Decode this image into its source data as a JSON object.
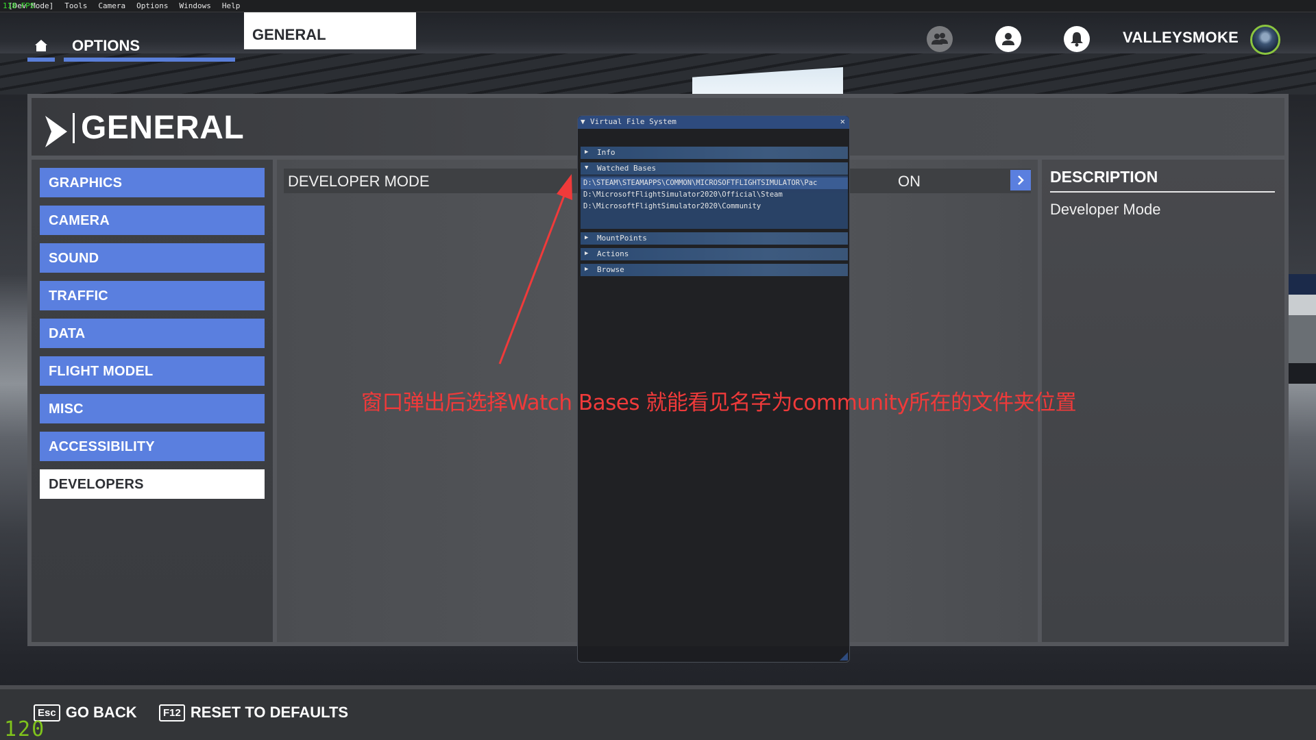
{
  "devbar": {
    "fps": "118 FPS",
    "mode_label": "[Dev Mode]",
    "menus": [
      "Tools",
      "Camera",
      "Options",
      "Windows",
      "Help"
    ]
  },
  "topnav": {
    "options_label": "OPTIONS",
    "current_tab": "GENERAL",
    "username": "VALLEYSMOKE",
    "accent_color": "#5a7fdf"
  },
  "page": {
    "title": "GENERAL"
  },
  "sidebar": {
    "items": [
      {
        "label": "GRAPHICS",
        "active": false
      },
      {
        "label": "CAMERA",
        "active": false
      },
      {
        "label": "SOUND",
        "active": false
      },
      {
        "label": "TRAFFIC",
        "active": false
      },
      {
        "label": "DATA",
        "active": false
      },
      {
        "label": "FLIGHT MODEL",
        "active": false
      },
      {
        "label": "MISC",
        "active": false
      },
      {
        "label": "ACCESSIBILITY",
        "active": false
      },
      {
        "label": "DEVELOPERS",
        "active": true
      }
    ]
  },
  "setting": {
    "label": "DEVELOPER MODE",
    "value": "ON"
  },
  "description": {
    "title": "DESCRIPTION",
    "text": "Developer Mode"
  },
  "vfs": {
    "title": "Virtual File System",
    "sections": {
      "info": "Info",
      "watched_bases": "Watched Bases",
      "mount_points": "MountPoints",
      "actions": "Actions",
      "browse": "Browse"
    },
    "watched_bases": [
      "D:\\STEAM\\STEAMAPPS\\COMMON\\MICROSOFTFLIGHTSIMULATOR\\Pac",
      "D:\\MicrosoftFlightSimulator2020\\Official\\Steam",
      "D:\\MicrosoftFlightSimulator2020\\Community"
    ]
  },
  "annotation": {
    "text": "窗口弹出后选择Watch Bases 就能看见名字为community所在的文件夹位置",
    "color": "#f03a3a"
  },
  "bottombar": {
    "go_back_key": "Esc",
    "go_back_label": "GO BACK",
    "reset_key": "F12",
    "reset_label": "RESET TO DEFAULTS"
  },
  "fps_counter": "120"
}
